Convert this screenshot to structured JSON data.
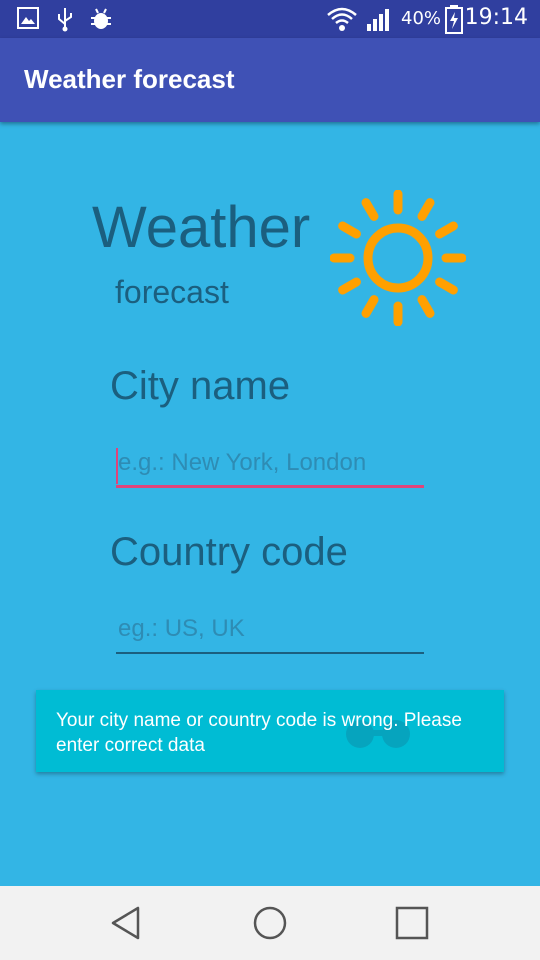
{
  "status_bar": {
    "battery_text": "40%",
    "time": "19:14",
    "icons": [
      "image-icon",
      "usb-icon",
      "bug-icon",
      "wifi-icon",
      "signal-icon",
      "battery-charging-icon"
    ]
  },
  "app_bar": {
    "title": "Weather forecast"
  },
  "logo": {
    "title": "Weather",
    "subtitle": "forecast",
    "icon": "sun-icon",
    "icon_color": "#FFA000"
  },
  "form": {
    "city_label": "City name",
    "city_placeholder": "e.g.: New York, London",
    "country_label": "Country code",
    "country_placeholder": "eg.: US, UK"
  },
  "toast": {
    "message": "Your city name or country code is wrong. Please enter correct data"
  },
  "nav_bar": {
    "icons": [
      "back-icon",
      "home-icon",
      "recents-icon"
    ]
  },
  "colors": {
    "background": "#33B5E5",
    "app_bar": "#3F51B5",
    "status_bar": "#303F9F",
    "text_dark": "#1B5F7F",
    "accent": "#E0447B",
    "toast": "#00BCD4"
  }
}
